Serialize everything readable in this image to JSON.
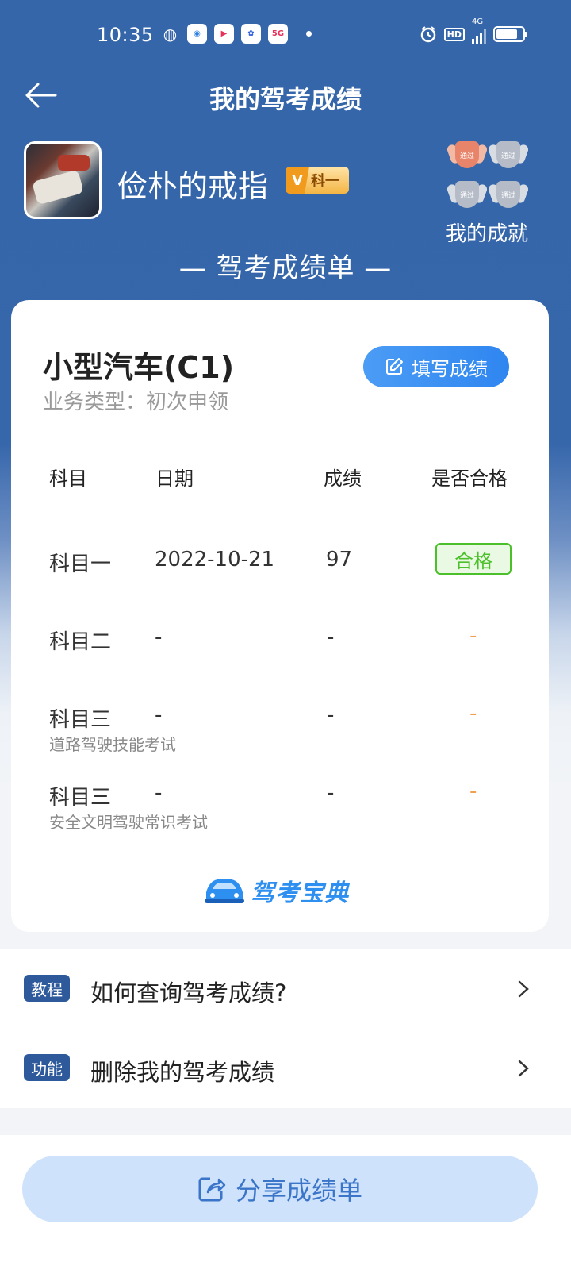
{
  "status_bar": {
    "time": "10:35",
    "network": "4G",
    "hd": "HD",
    "app_5g": "5G"
  },
  "header": {
    "title": "我的驾考成绩"
  },
  "profile": {
    "username": "俭朴的戒指",
    "level_badge": "科一",
    "achievements_label": "我的成就",
    "medals": [
      "通过",
      "通过",
      "通过",
      "通过"
    ]
  },
  "report": {
    "title": "— 驾考成绩单 —"
  },
  "card": {
    "car_type": "小型汽车(C1)",
    "business_type": "业务类型：初次申领",
    "fill_button_label": "填写成绩",
    "headers": {
      "subject": "科目",
      "date": "日期",
      "score": "成绩",
      "passed": "是否合格"
    },
    "rows": [
      {
        "subject": "科目一",
        "sub": "",
        "date": "2022-10-21",
        "score": "97",
        "passed": "合格"
      },
      {
        "subject": "科目二",
        "sub": "",
        "date": "-",
        "score": "-",
        "passed": "-"
      },
      {
        "subject": "科目三",
        "sub": "道路驾驶技能考试",
        "date": "-",
        "score": "-",
        "passed": "-"
      },
      {
        "subject": "科目三",
        "sub": "安全文明驾驶常识考试",
        "date": "-",
        "score": "-",
        "passed": "-"
      }
    ],
    "brand": "驾考宝典"
  },
  "list": [
    {
      "tag": "教程",
      "text": "如何查询驾考成绩?"
    },
    {
      "tag": "功能",
      "text": "删除我的驾考成绩"
    }
  ],
  "share_button_label": "分享成绩单",
  "colors": {
    "header_blue": "#3566a9",
    "accent_blue": "#2f86f0",
    "pass_green": "#4cc02a",
    "tag_blue": "#2e5a9c"
  }
}
